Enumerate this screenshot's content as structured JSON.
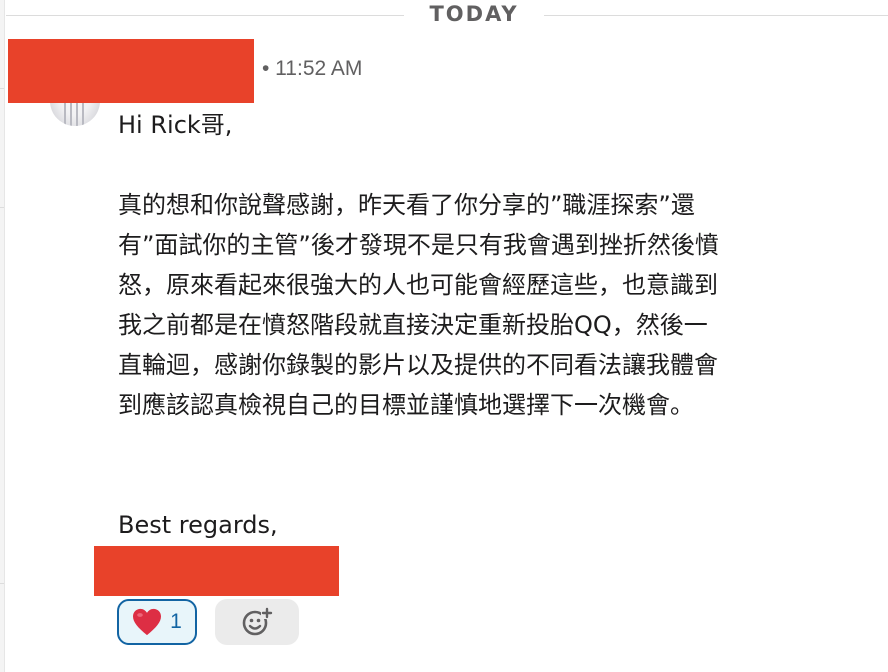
{
  "divider": {
    "label": "TODAY"
  },
  "message": {
    "time": "• 11:52 AM",
    "greeting": "Hi Rick哥,",
    "body_lines": [
      "真的想和你說聲感謝，昨天看了你分享的”職涯探索”還",
      "有”面試你的主管”後才發現不是只有我會遇到挫折然後憤",
      "怒，原來看起來很強大的人也可能會經歷這些，也意識到",
      "我之前都是在憤怒階段就直接決定重新投胎QQ，然後一",
      "直輪迴，感謝你錄製的影片以及提供的不同看法讓我體會",
      "到應該認真檢視自己的目標並謹慎地選擇下一次機會。"
    ],
    "closing": "Best regards,"
  },
  "reactions": [
    {
      "emoji": "heart-icon",
      "count": "1"
    }
  ],
  "colors": {
    "redaction": "#e8422a",
    "reaction_border": "#1264a3",
    "reaction_bg": "#e8f5fa",
    "heart": "#dd2e44"
  }
}
